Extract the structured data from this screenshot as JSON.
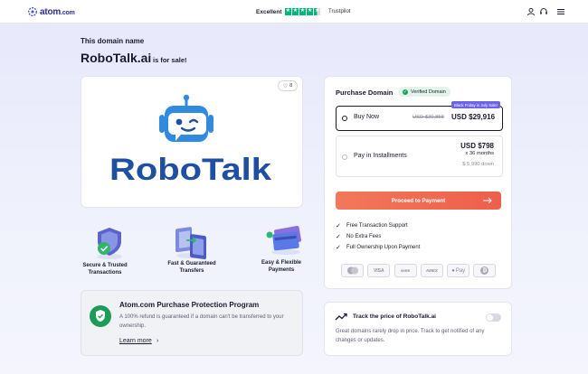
{
  "header": {
    "logo_text": "atom",
    "logo_suffix": ".com",
    "trust_label": "Excellent",
    "trust_brand": "Trustpilot",
    "icons": [
      "user-icon",
      "headset-icon",
      "menu-icon"
    ]
  },
  "intro": {
    "label": "This domain name",
    "domain": "RoboTalk.ai",
    "for_sale": "is for sale!"
  },
  "logo_card": {
    "likes": "8",
    "brand_wordmark": "RoboTalk",
    "colors": {
      "robot": "#2f8ae0",
      "wordmark": "#1f4fa0",
      "wordmark_accent": "#2f8ae0"
    }
  },
  "features": [
    {
      "label_line1": "Secure & Trusted",
      "label_line2": "Transactions",
      "icon": "shield-check-icon"
    },
    {
      "label_line1": "Fast & Guaranteed",
      "label_line2": "Transfers",
      "icon": "transfer-icon"
    },
    {
      "label_line1": "Easy & Flexible",
      "label_line2": "Payments",
      "icon": "cards-icon"
    }
  ],
  "protection": {
    "title": "Atom.com Purchase Protection Program",
    "description": "A 100% refund is guaranteed if a domain can't be transferred to your ownership.",
    "link": "Learn more"
  },
  "purchase": {
    "title": "Purchase Domain",
    "verified": "Verified Domain",
    "promo": "Black Friday in July Sale!",
    "buy_now": {
      "label": "Buy Now",
      "old_price": "USD $39,858",
      "price": "USD $29,916",
      "selected": true
    },
    "installments": {
      "label": "Pay in Installments",
      "price": "USD $798",
      "months": "x 36 months",
      "down": "$ 5,990 down",
      "selected": false
    },
    "button": "Proceed to Payment",
    "benefits": [
      "Free Transaction Support",
      "No Extra Fees",
      "Full Ownership Upon Payment"
    ],
    "payment_methods": [
      "Mastercard",
      "VISA",
      "WIRE TRANSFER",
      "AMEX",
      "Apple Pay",
      "Bitcoin"
    ],
    "payment_marks": [
      "",
      "VISA",
      "WIRE",
      "AMEX",
      "Pay",
      "₿"
    ],
    "colors": {
      "button": "#ef6a50",
      "promo": "#6d63e8",
      "verified": "#1fa05a"
    }
  },
  "track": {
    "title": "Track the price of RoboTalk.ai",
    "description": "Great domains rarely drop in price. Track to get notified of any changes or updates.",
    "enabled": false
  }
}
